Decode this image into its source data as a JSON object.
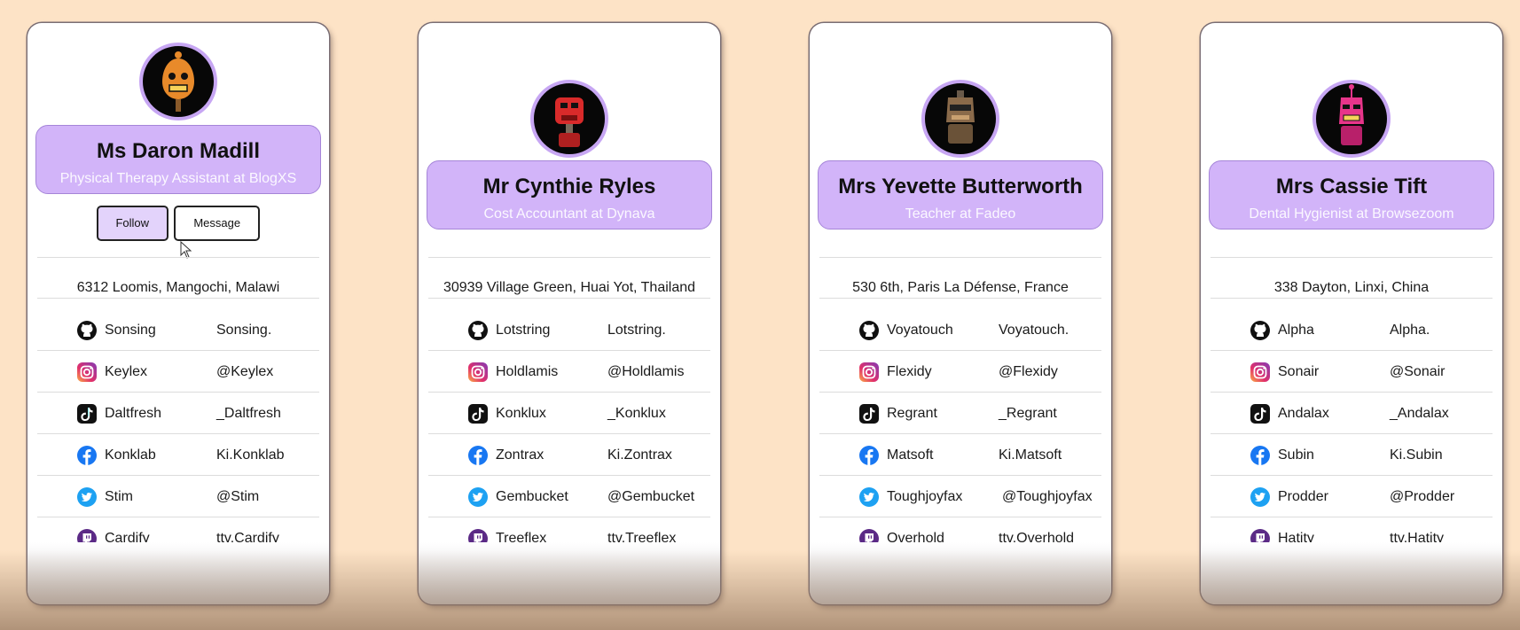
{
  "cards": [
    {
      "name": "Ms Daron Madill",
      "title": "Physical Therapy Assistant at BlogXS",
      "follow_label": "Follow",
      "message_label": "Message",
      "address": "6312 Loomis, Mangochi, Malawi",
      "avatar_color": "#e88a2a",
      "socials": [
        {
          "icon": "github-icon",
          "name": "Sonsing",
          "handle": "Sonsing."
        },
        {
          "icon": "instagram-icon",
          "name": "Keylex",
          "handle": "@Keylex"
        },
        {
          "icon": "tiktok-icon",
          "name": "Daltfresh",
          "handle": "_Daltfresh"
        },
        {
          "icon": "facebook-icon",
          "name": "Konklab",
          "handle": "Ki.Konklab"
        },
        {
          "icon": "twitter-icon",
          "name": "Stim",
          "handle": "@Stim"
        },
        {
          "icon": "twitch-icon",
          "name": "Cardify",
          "handle": "ttv.Cardify"
        }
      ]
    },
    {
      "name": "Mr Cynthie Ryles",
      "title": "Cost Accountant at Dynava",
      "address": "30939 Village Green, Huai Yot, Thailand",
      "avatar_color": "#d92a2a",
      "socials": [
        {
          "icon": "github-icon",
          "name": "Lotstring",
          "handle": "Lotstring."
        },
        {
          "icon": "instagram-icon",
          "name": "Holdlamis",
          "handle": "@Holdlamis"
        },
        {
          "icon": "tiktok-icon",
          "name": "Konklux",
          "handle": "_Konklux"
        },
        {
          "icon": "facebook-icon",
          "name": "Zontrax",
          "handle": "Ki.Zontrax"
        },
        {
          "icon": "twitter-icon",
          "name": "Gembucket",
          "handle": "@Gembucket"
        },
        {
          "icon": "twitch-icon",
          "name": "Treeflex",
          "handle": "ttv.Treeflex"
        }
      ]
    },
    {
      "name": "Mrs Yevette Butterworth",
      "title": "Teacher at Fadeo",
      "address": "530 6th, Paris La Défense, France",
      "avatar_color": "#8a6a4a",
      "socials": [
        {
          "icon": "github-icon",
          "name": "Voyatouch",
          "handle": "Voyatouch."
        },
        {
          "icon": "instagram-icon",
          "name": "Flexidy",
          "handle": "@Flexidy"
        },
        {
          "icon": "tiktok-icon",
          "name": "Regrant",
          "handle": "_Regrant"
        },
        {
          "icon": "facebook-icon",
          "name": "Matsoft",
          "handle": "Ki.Matsoft"
        },
        {
          "icon": "twitter-icon",
          "name": "Toughjoyfax",
          "handle": "@Toughjoyfax"
        },
        {
          "icon": "twitch-icon",
          "name": "Overhold",
          "handle": "ttv.Overhold"
        }
      ]
    },
    {
      "name": "Mrs Cassie Tift",
      "title": "Dental Hygienist at Browsezoom",
      "address": "338 Dayton, Linxi, China",
      "avatar_color": "#e8358a",
      "socials": [
        {
          "icon": "github-icon",
          "name": "Alpha",
          "handle": "Alpha."
        },
        {
          "icon": "instagram-icon",
          "name": "Sonair",
          "handle": "@Sonair"
        },
        {
          "icon": "tiktok-icon",
          "name": "Andalax",
          "handle": "_Andalax"
        },
        {
          "icon": "facebook-icon",
          "name": "Subin",
          "handle": "Ki.Subin"
        },
        {
          "icon": "twitter-icon",
          "name": "Prodder",
          "handle": "@Prodder"
        },
        {
          "icon": "twitch-icon",
          "name": "Hatity",
          "handle": "ttv.Hatity"
        }
      ]
    }
  ]
}
